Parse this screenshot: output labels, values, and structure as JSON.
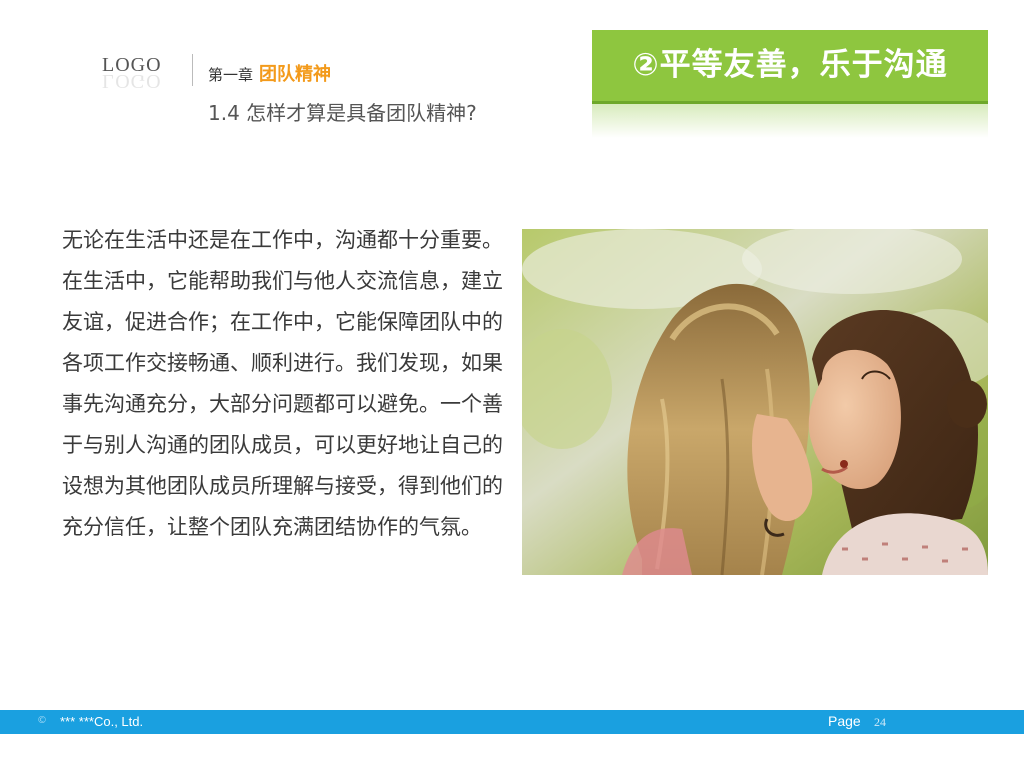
{
  "header": {
    "logo": "LOGO",
    "chapter_prefix": "第一章",
    "chapter_title": "团队精神",
    "section_title": "1.4 怎样才算是具备团队精神?"
  },
  "banner": {
    "text": "②平等友善，乐于沟通",
    "color": "#8ec63f"
  },
  "body": {
    "paragraph": "无论在生活中还是在工作中，沟通都十分重要。在生活中，它能帮助我们与他人交流信息，建立友谊，促进合作；在工作中，它能保障团队中的各项工作交接畅通、顺利进行。我们发现，如果事先沟通充分，大部分问题都可以避免。一个善于与别人沟通的团队成员，可以更好地让自己的设想为其他团队成员所理解与接受，得到他们的充分信任，让整个团队充满团结协作的气氛。"
  },
  "footer": {
    "bullet": "©",
    "company": "*** ***Co., Ltd.",
    "page_label": "Page",
    "page_number": "24",
    "color": "#1aa0e0"
  },
  "accent_colors": {
    "chapter_title": "#f39a1b"
  }
}
